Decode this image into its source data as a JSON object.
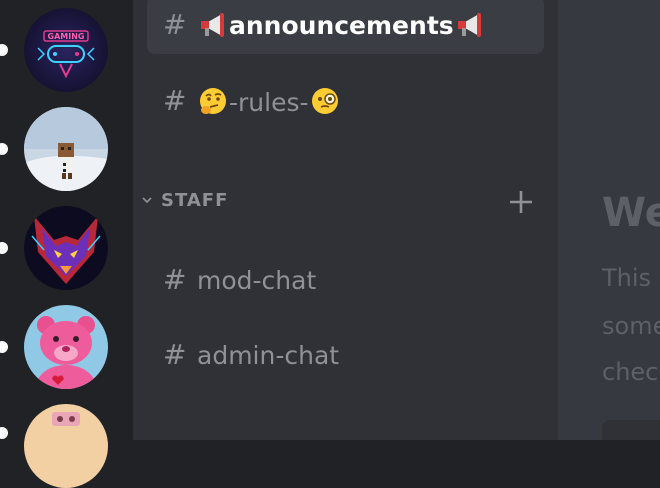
{
  "servers": [
    {
      "name": "gaming-server",
      "badge_text": "GAMING"
    },
    {
      "name": "snowman-server"
    },
    {
      "name": "neon-wolf-server"
    },
    {
      "name": "pink-bear-server"
    },
    {
      "name": "partial-server"
    }
  ],
  "channels": [
    {
      "name": "announcements",
      "selected": true,
      "emoji_before": "megaphone",
      "emoji_after": "megaphone"
    },
    {
      "name": "-rules-",
      "selected": false,
      "emoji_before": "thinking-face",
      "emoji_after": "monocle-face"
    }
  ],
  "category": {
    "label": "STAFF",
    "channels": [
      {
        "name": "mod-chat"
      },
      {
        "name": "admin-chat"
      }
    ]
  },
  "hash_symbol": "#",
  "main": {
    "title": "We",
    "lines": [
      "This",
      "some",
      "chec"
    ]
  },
  "colors": {
    "rail_bg": "#202225",
    "sidebar_bg": "#2f3136",
    "selected_bg": "#3a3d43",
    "main_bg": "#36393f",
    "muted_text": "#8e9297",
    "selected_text": "#ffffff"
  }
}
